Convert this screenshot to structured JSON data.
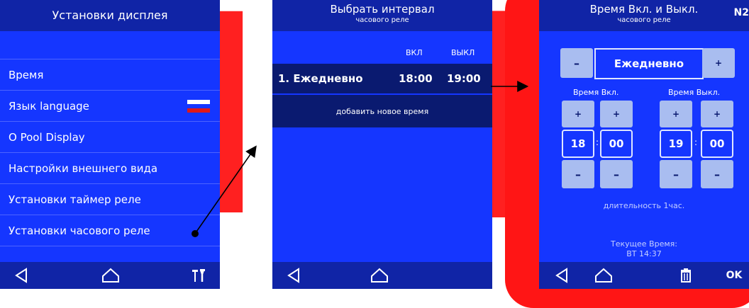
{
  "screen1": {
    "title": "Установки дисплея",
    "menu": [
      {
        "label": "Время"
      },
      {
        "label": "Язык language"
      },
      {
        "label": "O Pool Display"
      },
      {
        "label": "Настройки внешнего вида"
      },
      {
        "label": "Установки таймер реле"
      },
      {
        "label": "Установки часового реле"
      }
    ],
    "flag_colors": [
      "#ffffff",
      "#1536ff",
      "#e01818"
    ]
  },
  "screen2": {
    "title": "Выбрать интервал",
    "subtitle": "часового реле",
    "col_on": "ВКЛ",
    "col_off": "ВЫКЛ",
    "row": {
      "name": "1. Ежедневно",
      "on": "18:00",
      "off": "19:00"
    },
    "add_label": "добавить новое время"
  },
  "screen3": {
    "title": "Время Вкл. и Выкл.",
    "subtitle": "часового реле",
    "number": "N2",
    "minus": "–",
    "plus": "+",
    "mode": "Ежедневно",
    "on_label": "Время Вкл.",
    "off_label": "Время Выкл.",
    "on_hour": "18",
    "on_min": "00",
    "off_hour": "19",
    "off_min": "00",
    "colon": ":",
    "duration": "длительность 1час.",
    "current_label": "Текущее Время:",
    "current_value": "ВТ 14:37",
    "ok": "OK"
  },
  "colors": {
    "screen_bg": "#1536ff",
    "header_bg": "#1024a6",
    "button_bg": "#a9bdf0",
    "watermark": "#ff1515"
  }
}
